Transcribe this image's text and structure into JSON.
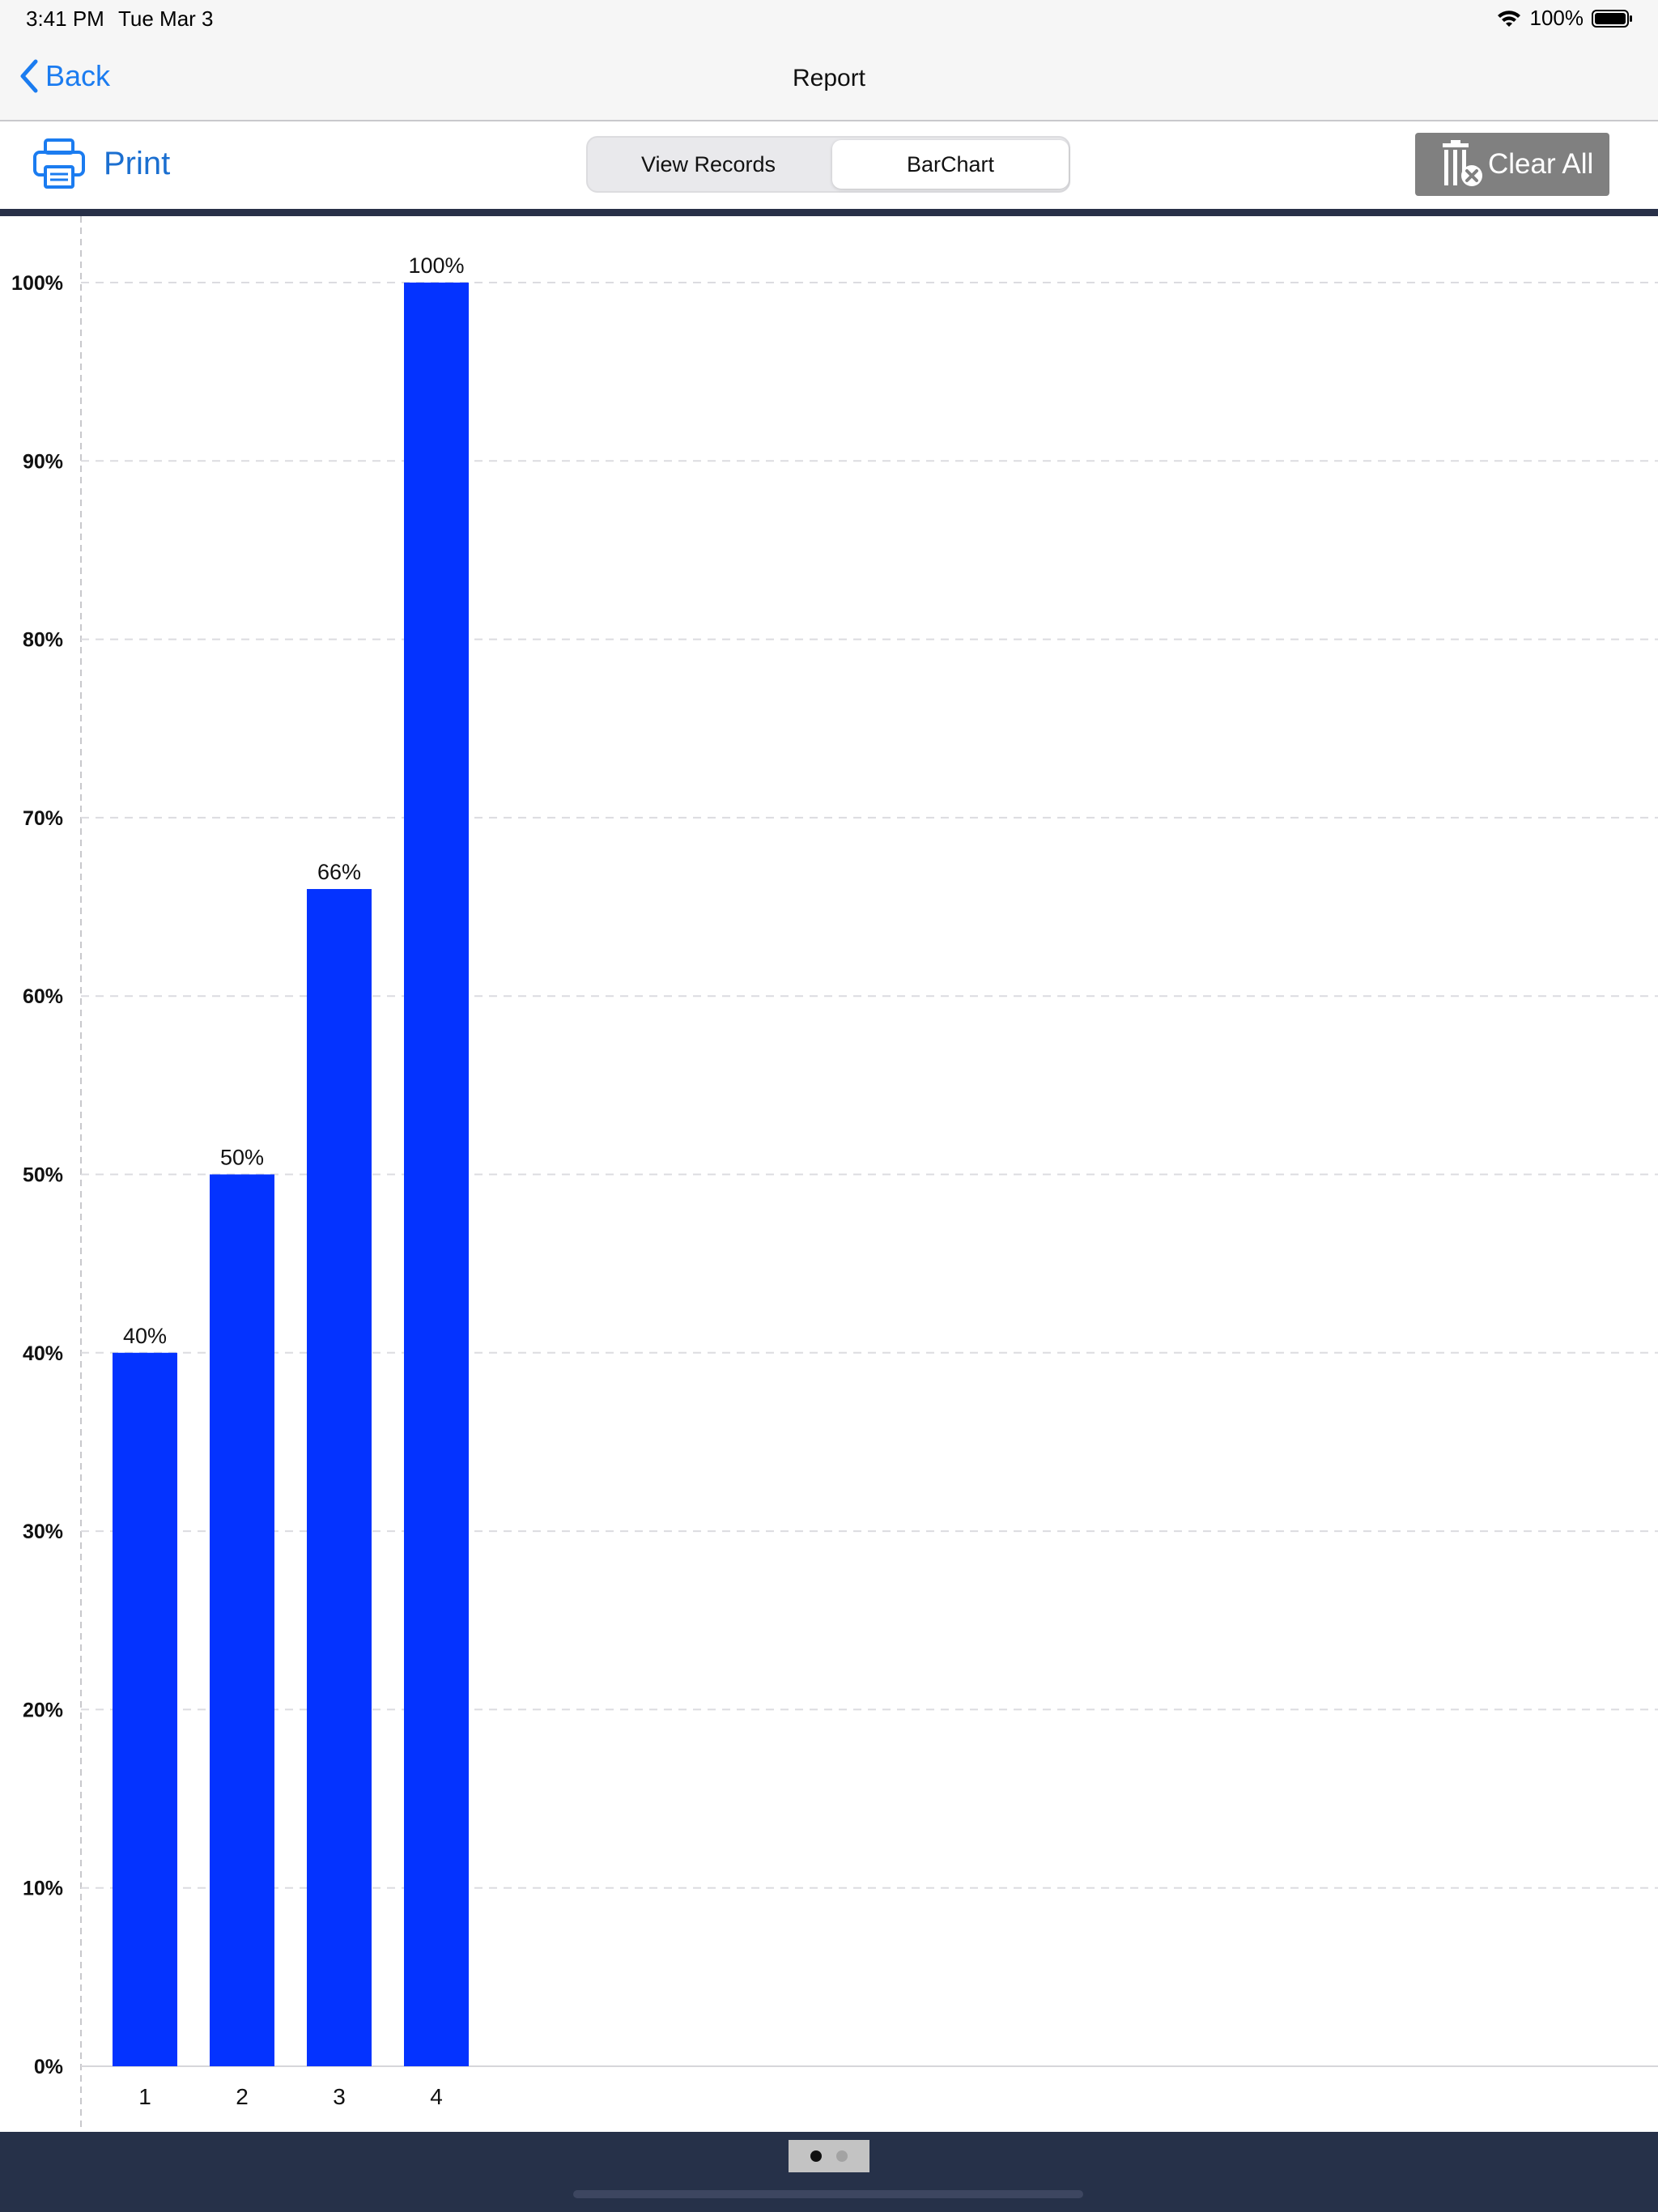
{
  "status": {
    "time": "3:41 PM",
    "date": "Tue Mar 3",
    "battery": "100%"
  },
  "nav": {
    "back_label": "Back",
    "title": "Report"
  },
  "toolbar": {
    "print_label": "Print",
    "tabs": [
      {
        "label": "View Records",
        "selected": false
      },
      {
        "label": "BarChart",
        "selected": true
      }
    ],
    "clear_label": "Clear All"
  },
  "colors": {
    "bar": "#0433ff",
    "accent": "#1b7cf0",
    "dark_bar": "#283048"
  },
  "chart_data": {
    "type": "bar",
    "categories": [
      "1",
      "2",
      "3",
      "4"
    ],
    "values": [
      40,
      50,
      66,
      100
    ],
    "value_labels": [
      "40%",
      "50%",
      "66%",
      "100%"
    ],
    "ylim": [
      0,
      100
    ],
    "yticks": [
      "0%",
      "10%",
      "20%",
      "30%",
      "40%",
      "50%",
      "60%",
      "70%",
      "80%",
      "90%",
      "100%"
    ],
    "grid": true,
    "legend": false
  },
  "pager": {
    "pages": 2,
    "current": 1
  }
}
